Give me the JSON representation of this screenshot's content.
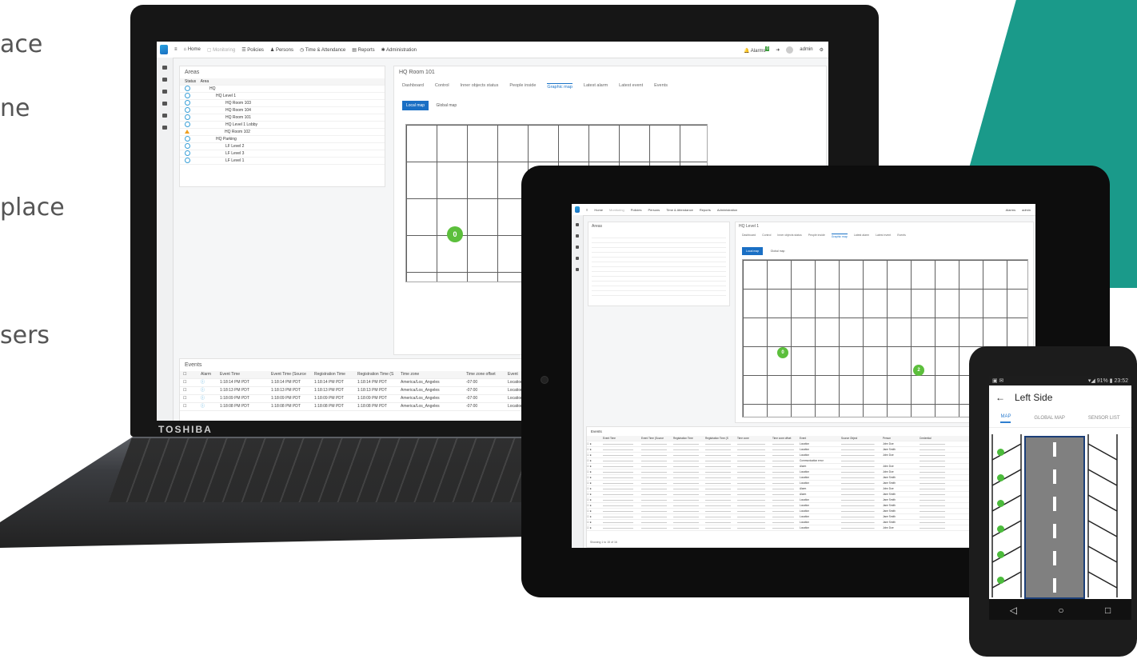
{
  "left_text": [
    "ace",
    "ne",
    "place",
    "sers"
  ],
  "laptop": {
    "brand": "TOSHIBA",
    "nav": [
      "Home",
      "Monitoring",
      "Policies",
      "Persons",
      "Time & Attendance",
      "Reports",
      "Administration"
    ],
    "alarms_label": "Alarms",
    "alarms_count": "0",
    "user": "admin",
    "areas_title": "Areas",
    "area_header": [
      "Status",
      "Area"
    ],
    "areas": [
      "HQ",
      "HQ Level 1",
      "HQ Room 103",
      "HQ Room 104",
      "HQ Room 101",
      "HQ Level 1 Lobby",
      "HQ Room 102",
      "HQ Parking",
      "LF Level 2",
      "LF Level 3",
      "LF Level 1"
    ],
    "detail_title": "HQ Room 101",
    "tabs": [
      "Dashboard",
      "Control",
      "Inner objects status",
      "People inside",
      "Graphic map",
      "Latest alarm",
      "Latest event",
      "Events"
    ],
    "map_buttons": [
      "Local map",
      "Global map"
    ],
    "pin": "0",
    "events_title": "Events",
    "events_header": [
      "Alarm",
      "Event Time",
      "Event Time (Source",
      "Registration Time",
      "Registration Time (S",
      "Time zone",
      "Time zone offset",
      "Event"
    ],
    "events_rows": [
      [
        "1:18:14 PM PDT",
        "1:18:14 PM PDT",
        "1:18:14 PM PDT",
        "1:18:14 PM PDT",
        "America/Los_Angeles",
        "-07:00",
        "Location"
      ],
      [
        "1:18:13 PM PDT",
        "1:18:13 PM PDT",
        "1:18:13 PM PDT",
        "1:18:13 PM PDT",
        "America/Los_Angeles",
        "-07:00",
        "Location"
      ],
      [
        "1:18:09 PM PDT",
        "1:18:09 PM PDT",
        "1:18:09 PM PDT",
        "1:18:09 PM PDT",
        "America/Los_Angeles",
        "-07:00",
        "Location"
      ],
      [
        "1:18:08 PM PDT",
        "1:18:08 PM PDT",
        "1:18:08 PM PDT",
        "1:18:08 PM PDT",
        "America/Los_Angeles",
        "-07:00",
        "Location"
      ]
    ]
  },
  "tablet": {
    "detail_title": "HQ Level 1",
    "areas_title": "Areas",
    "pins": [
      "0",
      "2"
    ],
    "events_title": "Events",
    "event_buttons": [
      "Refresh",
      "Acknowledge"
    ],
    "events_header": [
      "Alarm",
      "Event Time",
      "Event Time (Source",
      "Registration Time",
      "Registration Time (S",
      "Time zone",
      "Time zone offset",
      "Event",
      "Source Object",
      "Person",
      "Credential"
    ],
    "event_types": [
      "Location",
      "Location",
      "Location",
      "Communication error",
      "Alarm",
      "Location",
      "Location",
      "Location",
      "Alarm",
      "Alarm",
      "Location",
      "Location",
      "Location",
      "Location",
      "Location",
      "Location"
    ],
    "persons": [
      "John Doe",
      "Jane Smith",
      "John Doe",
      "",
      "John Doe",
      "John Doe",
      "Jane Smith",
      "Jane Smith",
      "John Doe",
      "Jane Smith",
      "Jane Smith",
      "Jane Smith",
      "Jane Smith",
      "Jane Smith",
      "Jane Smith",
      "John Doe"
    ],
    "footer": "Showing 1 to 15 of 16"
  },
  "phone": {
    "status_time": "23:52",
    "battery": "91%",
    "title": "Left Side",
    "tabs": [
      "MAP",
      "GLOBAL MAP",
      "SENSOR LIST"
    ],
    "nav": [
      "◁",
      "○",
      "□"
    ]
  }
}
